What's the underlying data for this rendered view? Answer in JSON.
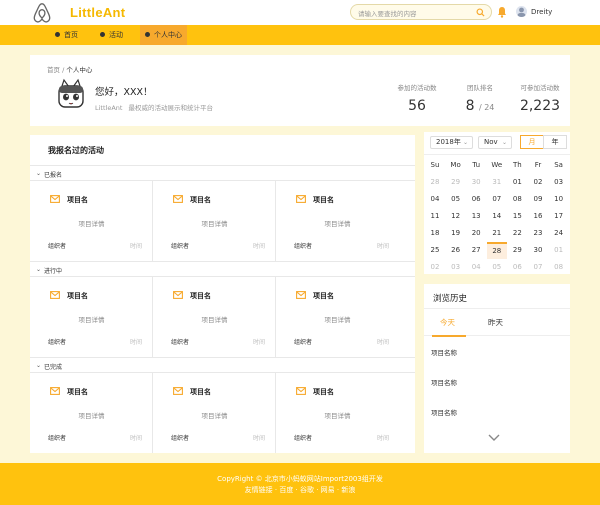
{
  "header": {
    "logo_text": "LittleAnt",
    "search_placeholder": "请输入要查找的内容",
    "username": "Dreity"
  },
  "nav": {
    "items": [
      {
        "label": "首页"
      },
      {
        "label": "活动"
      },
      {
        "label": "个人中心"
      }
    ],
    "active_index": 2
  },
  "profile": {
    "breadcrumb_home": "首页",
    "breadcrumb_sep": " / ",
    "breadcrumb_current": "个人中心",
    "greeting": "您好，XXX！",
    "site_name": "LittleAnt",
    "site_tagline": "最权威的活动展示和统计平台",
    "stats": [
      {
        "label": "参加的活动数",
        "value": "56"
      },
      {
        "label": "团队排名",
        "value": "8",
        "total": "24"
      },
      {
        "label": "可参加活动数",
        "value": "2,223"
      }
    ]
  },
  "activities": {
    "title": "我报名过的活动",
    "groups": [
      {
        "label": "已报名",
        "cards": [
          {
            "name": "项目名",
            "detail": "项目详情",
            "organizer": "组织者",
            "time": "时间"
          },
          {
            "name": "项目名",
            "detail": "项目详情",
            "organizer": "组织者",
            "time": "时间"
          },
          {
            "name": "项目名",
            "detail": "项目详情",
            "organizer": "组织者",
            "time": "时间"
          }
        ]
      },
      {
        "label": "进行中",
        "cards": [
          {
            "name": "项目名",
            "detail": "项目详情",
            "organizer": "组织者",
            "time": "时间"
          },
          {
            "name": "项目名",
            "detail": "项目详情",
            "organizer": "组织者",
            "time": "时间"
          },
          {
            "name": "项目名",
            "detail": "项目详情",
            "organizer": "组织者",
            "time": "时间"
          }
        ]
      },
      {
        "label": "已完成",
        "cards": [
          {
            "name": "项目名",
            "detail": "项目详情",
            "organizer": "组织者",
            "time": "时间"
          },
          {
            "name": "项目名",
            "detail": "项目详情",
            "organizer": "组织者",
            "time": "时间"
          },
          {
            "name": "项目名",
            "detail": "项目详情",
            "organizer": "组织者",
            "time": "时间"
          }
        ]
      }
    ]
  },
  "calendar": {
    "year_select": "2018年",
    "month_select": "Nov",
    "mode_month": "月",
    "mode_year": "年",
    "active_mode": "month",
    "weekdays": [
      "Su",
      "Mo",
      "Tu",
      "We",
      "Th",
      "Fr",
      "Sa"
    ],
    "weeks": [
      [
        {
          "d": "28",
          "m": true
        },
        {
          "d": "29",
          "m": true
        },
        {
          "d": "30",
          "m": true
        },
        {
          "d": "31",
          "m": true
        },
        {
          "d": "01"
        },
        {
          "d": "02"
        },
        {
          "d": "03"
        }
      ],
      [
        {
          "d": "04"
        },
        {
          "d": "05"
        },
        {
          "d": "06"
        },
        {
          "d": "07"
        },
        {
          "d": "08"
        },
        {
          "d": "09"
        },
        {
          "d": "10"
        }
      ],
      [
        {
          "d": "11"
        },
        {
          "d": "12"
        },
        {
          "d": "13"
        },
        {
          "d": "14"
        },
        {
          "d": "15"
        },
        {
          "d": "16"
        },
        {
          "d": "17"
        }
      ],
      [
        {
          "d": "18"
        },
        {
          "d": "19"
        },
        {
          "d": "20"
        },
        {
          "d": "21"
        },
        {
          "d": "22"
        },
        {
          "d": "23"
        },
        {
          "d": "24"
        }
      ],
      [
        {
          "d": "25"
        },
        {
          "d": "26"
        },
        {
          "d": "27"
        },
        {
          "d": "28",
          "today": true
        },
        {
          "d": "29"
        },
        {
          "d": "30"
        },
        {
          "d": "01",
          "m": true
        }
      ],
      [
        {
          "d": "02",
          "m": true
        },
        {
          "d": "03",
          "m": true
        },
        {
          "d": "04",
          "m": true
        },
        {
          "d": "05",
          "m": true
        },
        {
          "d": "06",
          "m": true
        },
        {
          "d": "07",
          "m": true
        },
        {
          "d": "08",
          "m": true
        }
      ]
    ]
  },
  "history": {
    "title": "浏览历史",
    "tabs": [
      {
        "label": "今天"
      },
      {
        "label": "昨天"
      }
    ],
    "active_tab": 0,
    "items": [
      {
        "label": "项目名称"
      },
      {
        "label": "项目名称"
      },
      {
        "label": "项目名称"
      }
    ]
  },
  "footer": {
    "copyright": "CopyRight © 北京市小蚂蚁网站Import2003组开发",
    "links": "友情链接 · 百度 · 谷歌 · 网易 · 新浪"
  },
  "colors": {
    "brand": "#ffc20e",
    "accent": "#f7a92d",
    "page_bg": "#fdf7d7"
  }
}
